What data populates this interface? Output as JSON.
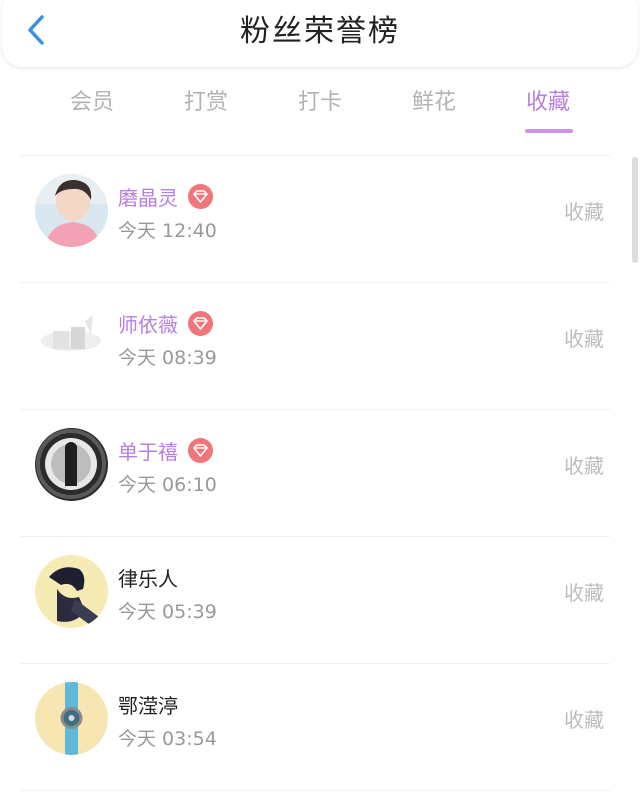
{
  "header": {
    "title": "粉丝荣誉榜",
    "back_icon": "chevron-left-icon",
    "accent": "#3a8ee6"
  },
  "tabs": [
    {
      "label": "会员",
      "active": false
    },
    {
      "label": "打赏",
      "active": false
    },
    {
      "label": "打卡",
      "active": false
    },
    {
      "label": "鲜花",
      "active": false
    },
    {
      "label": "收藏",
      "active": true
    }
  ],
  "colors": {
    "active_tab": "#b67fe0",
    "vip_name": "#b67fe0",
    "vip_badge": "#f2757a",
    "muted": "#999999"
  },
  "fans": [
    {
      "name": "磨晶灵",
      "vip": true,
      "badge_icon": "diamond-icon",
      "time": "今天 12:40",
      "action": "收藏",
      "avatar": "avatar-photo-pink-shirt"
    },
    {
      "name": "师依薇",
      "vip": true,
      "badge_icon": "diamond-icon",
      "time": "今天 08:39",
      "action": "收藏",
      "avatar": "avatar-photo-white-abstract"
    },
    {
      "name": "单于禧",
      "vip": true,
      "badge_icon": "diamond-icon",
      "time": "今天 06:10",
      "action": "收藏",
      "avatar": "avatar-photo-dark-room"
    },
    {
      "name": "律乐人",
      "vip": false,
      "badge_icon": "",
      "time": "今天 05:39",
      "action": "收藏",
      "avatar": "avatar-photo-sketch-man"
    },
    {
      "name": "鄂滢渟",
      "vip": false,
      "badge_icon": "",
      "time": "今天 03:54",
      "action": "收藏",
      "avatar": "avatar-photo-watch"
    }
  ]
}
